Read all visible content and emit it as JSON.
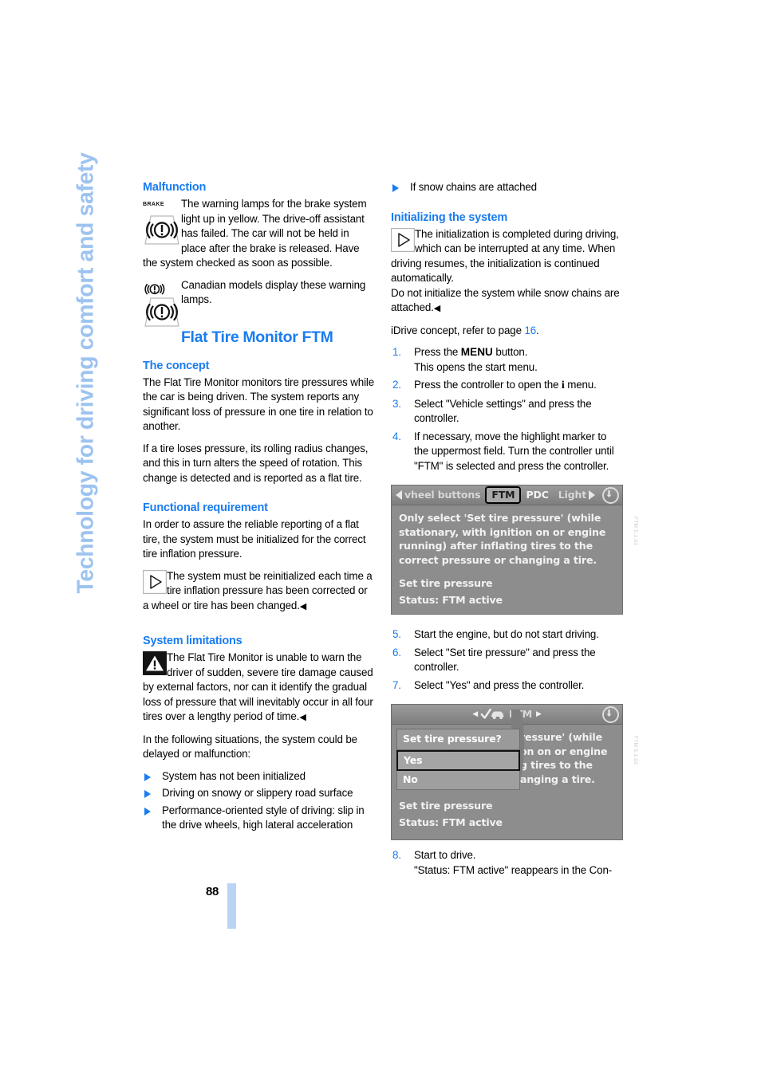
{
  "chapter": {
    "vertical_title": "Technology for driving comfort and safety"
  },
  "page": {
    "number": "88"
  },
  "left_column": {
    "malfunction_heading": "Malfunction",
    "brake_lamp_label": "BRAKE",
    "malfunction_note": "The warning lamps for the brake system light up in yellow. The drive-off assistant has failed. The car will not be held in place after the brake is released. Have the system checked as soon as possible.",
    "canadian_note": "Canadian models display these warning lamps.",
    "ftm_heading": "Flat Tire Monitor FTM",
    "concept_heading": "The concept",
    "concept_p1": "The Flat Tire Monitor monitors tire pressures while the car is being driven. The system reports any significant loss of pressure in one tire in relation to another.",
    "concept_p2": "If a tire loses pressure, its rolling radius changes, and this in turn alters the speed of rotation. This change is detected and is reported as a flat tire.",
    "functional_heading": "Functional requirement",
    "functional_p1": "In order to assure the reliable reporting of a flat tire, the system must be initialized for the correct tire inflation pressure.",
    "functional_note": "The system must be reinitialized each time a tire inflation pressure has been corrected or a wheel or tire has been changed.",
    "limitations_heading": "System limitations",
    "limitations_warning": "The Flat Tire Monitor is unable to warn the driver of sudden, severe tire damage caused by external factors, nor can it identify the gradual loss of pressure that will inevitably occur in all four tires over a lengthy period of time.",
    "limitations_intro": "In the following situations, the system could be delayed or malfunction:",
    "limitations_items": [
      "System has not been initialized",
      "Driving on snowy or slippery road surface",
      "Performance-oriented style of driving: slip in the drive wheels, high lateral acceleration"
    ]
  },
  "right_column": {
    "continued_bullet": "If snow chains are attached",
    "initializing_heading": "Initializing the system",
    "initializing_note": "The initialization is completed during driving, which can be interrupted at any time. When driving resumes, the initialization is continued automatically.",
    "initializing_note2": "Do not initialize the system while snow chains are attached.",
    "idrive_ref_prefix": "iDrive concept, refer to page ",
    "idrive_ref_page": "16",
    "idrive_ref_suffix": ".",
    "steps": [
      {
        "n": "1.",
        "lines": [
          "Press the MENU button.",
          "This opens the start menu."
        ],
        "has_menu_kbd": true
      },
      {
        "n": "2.",
        "lines": [
          "Press the controller to open the i menu."
        ],
        "has_info_i": true
      },
      {
        "n": "3.",
        "lines": [
          "Select \"Vehicle settings\" and press the controller."
        ]
      },
      {
        "n": "4.",
        "lines": [
          "If necessary, move the highlight marker to the uppermost field. Turn the controller until \"FTM\" is selected and press the controller."
        ]
      },
      {
        "n": "5.",
        "lines": [
          "Start the engine, but do not start driving."
        ]
      },
      {
        "n": "6.",
        "lines": [
          "Select \"Set tire pressure\" and press the controller."
        ]
      },
      {
        "n": "7.",
        "lines": [
          "Select \"Yes\" and press the controller."
        ]
      },
      {
        "n": "8.",
        "lines": [
          "Start to drive.",
          "\"Status: FTM active\" reappears in the Con-"
        ]
      }
    ]
  },
  "idrive_screen_1": {
    "tabs": {
      "left_truncated": "vheel buttons",
      "selected": "FTM",
      "tab2": "PDC",
      "tab3_truncated": "Light"
    },
    "body_text": "Only select  'Set tire pressure' (while stationary, with ignition on or engine running) after inflating tires to the correct pressure or changing a tire.",
    "menu_item": "Set tire pressure",
    "status": "Status: FTM active",
    "caption": "FTM 5.1.01"
  },
  "idrive_screen_2": {
    "title": "FTM",
    "popup_title": "Set tire pressure?",
    "popup_options": [
      "Yes",
      "No"
    ],
    "background_text_lines": [
      "ressure' (while",
      "on on or engine",
      "g tires to the",
      "anging a tire."
    ],
    "menu_item": "Set tire pressure",
    "status": "Status:  FTM active",
    "caption": "FTM 5.1.02"
  },
  "colors": {
    "heading_blue": "#1a7cf0",
    "chapter_blue": "#9dc3f0",
    "page_bar_blue": "#bad4f5",
    "display_gray": "#8d8d8d"
  }
}
